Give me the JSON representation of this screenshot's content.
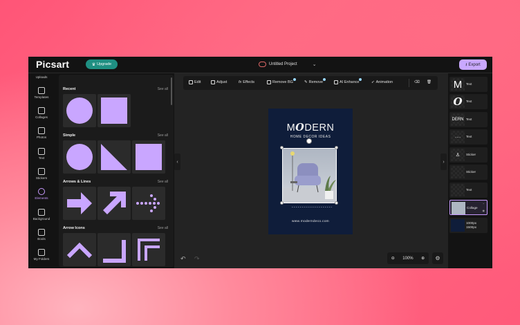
{
  "header": {
    "logo": "Picsart",
    "upgrade_label": "Upgrade",
    "project_title": "Untitled Project",
    "export_label": "Export"
  },
  "rail": {
    "items": [
      {
        "label": "Uploads",
        "icon": "upload-icon"
      },
      {
        "label": "Templates",
        "icon": "book-icon"
      },
      {
        "label": "Collages",
        "icon": "grid-icon"
      },
      {
        "label": "Photos",
        "icon": "image-icon"
      },
      {
        "label": "Text",
        "icon": "text-icon"
      },
      {
        "label": "Stickers",
        "icon": "sticker-icon"
      },
      {
        "label": "Elements",
        "icon": "star-icon",
        "active": true
      },
      {
        "label": "Background",
        "icon": "background-icon"
      },
      {
        "label": "Bools",
        "icon": "tool-icon"
      },
      {
        "label": "My Folders",
        "icon": "folder-icon"
      }
    ]
  },
  "panel": {
    "see_all": "See all",
    "sections": [
      {
        "title": "Recent"
      },
      {
        "title": "Simple"
      },
      {
        "title": "Arrows & Lines"
      },
      {
        "title": "Arrow Icons"
      }
    ]
  },
  "toolbar": {
    "items": [
      "Edit",
      "Adjust",
      "Effects",
      "Remove BG",
      "Remove",
      "AI Enhance",
      "Animation"
    ]
  },
  "poster": {
    "title_pre": "M",
    "title_o": "O",
    "title_post": "DERN",
    "subtitle": "HOME DECOR IDEAS",
    "url": "www.moderndeco.com"
  },
  "zoom": {
    "level": "100%"
  },
  "layers": [
    {
      "label": "Text",
      "thumb": "M"
    },
    {
      "label": "Text",
      "thumb": "O"
    },
    {
      "label": "Text",
      "thumb": "DERN"
    },
    {
      "label": "Text",
      "thumb": "......"
    },
    {
      "label": "Sticker",
      "thumb": ""
    },
    {
      "label": "Sticker",
      "thumb": ""
    },
    {
      "label": "Text",
      "thumb": ""
    },
    {
      "label": "Collage",
      "thumb": ""
    },
    {
      "label": "1000px 1500px",
      "thumb": ""
    }
  ],
  "colors": {
    "accent": "#c89aff",
    "upgrade": "#1f8f82",
    "poster_bg": "#0f1d3a",
    "shape": "#c9a6ff"
  }
}
